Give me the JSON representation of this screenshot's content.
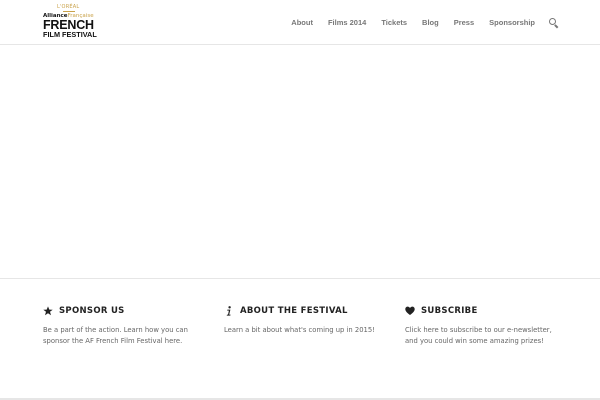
{
  "logo": {
    "brand": "L'ORÉAL",
    "alliance_bold": "Alliance",
    "alliance_light": "Française",
    "line1": "FRENCH",
    "line2": "FILM FESTIVAL"
  },
  "nav": {
    "items": [
      "About",
      "Films 2014",
      "Tickets",
      "Blog",
      "Press",
      "Sponsorship"
    ],
    "search_icon": "search-icon"
  },
  "footer": {
    "columns": [
      {
        "icon": "star-icon",
        "title": "SPONSOR US",
        "body": "Be a part of the action. Learn how you can sponsor the AF French Film Festival here."
      },
      {
        "icon": "info-icon",
        "title": "ABOUT THE FESTIVAL",
        "body": "Learn a bit about what's coming up in 2015!"
      },
      {
        "icon": "heart-icon",
        "title": "SUBSCRIBE",
        "body": "Click here to subscribe to our e-newsletter, and you could win some amazing prizes!"
      }
    ]
  },
  "colors": {
    "accent_gold": "#c9a24a",
    "nav_text": "#777777",
    "divider": "#e6e6e6"
  }
}
